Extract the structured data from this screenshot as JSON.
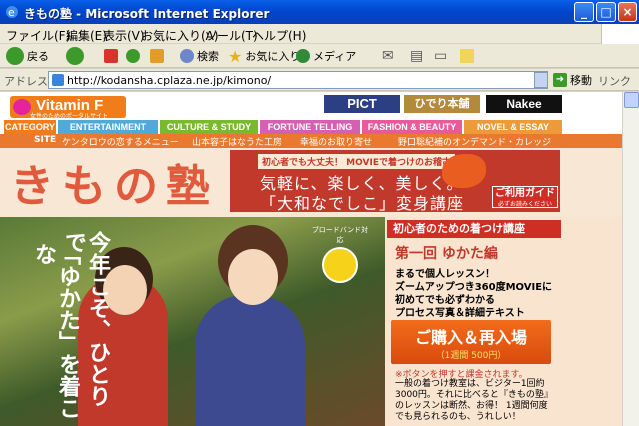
{
  "window": {
    "title": "きもの塾 - Microsoft Internet Explorer"
  },
  "menu": [
    "ファイル(F)",
    "編集(E)",
    "表示(V)",
    "お気に入り(A)",
    "ツール(T)",
    "ヘルプ(H)"
  ],
  "toolbar": {
    "back": "戻る",
    "search": "検索",
    "favorites": "お気に入り",
    "media": "メディア"
  },
  "address": {
    "label": "アドレス(D)",
    "url": "http://kodansha.cplaza.ne.jp/kimono/",
    "go": "移動",
    "links": "リンク"
  },
  "site": {
    "logo": "Vitamin F",
    "logo_sub": "女性のためのポータルサイト",
    "banners": [
      "PICT",
      "ひでり本舗",
      "Nakee"
    ],
    "categories": [
      {
        "label": "CATEGORY",
        "color": "#f07d1a"
      },
      {
        "label": "ENTERTAINMENT",
        "color": "#52a9d8"
      },
      {
        "label": "CULTURE & STUDY",
        "color": "#7ab830"
      },
      {
        "label": "FORTUNE TELLING",
        "color": "#d55fb0"
      },
      {
        "label": "FASHION & BEAUTY",
        "color": "#e85a9a"
      },
      {
        "label": "NOVEL & ESSAY",
        "color": "#ec9b38"
      }
    ],
    "site_label": "SITE",
    "site_links": [
      "ケンタロウの恋するメニュー",
      "山本容子はなうた工房",
      "幸福のお取り寄せ",
      "野口聡紀補のオンデマンド・カレッジ"
    ]
  },
  "hero": {
    "title": "きもの塾",
    "tag": "初心者でも大丈夫！ MOVIEで着つけのお稽古",
    "line1": "気軽に、楽しく、美しく。",
    "line2": "「大和なでしこ」変身講座",
    "guide": "ご利用ガイド",
    "guide_sub": "必ずお読みください"
  },
  "photo": {
    "text1": "今年こそ、ひとりで",
    "text2": "「ゆかた」を着こな",
    "broadband": "ブロードバンド対応"
  },
  "side": {
    "header": "初心者のための着つけ講座",
    "episode": "第一回 ゆかた編",
    "d1": "まるで個人レッスン！",
    "d2": "ズームアップつき360度MOVIEに",
    "d3": "初めてでも必ずわかる",
    "d4": "プロセス写真＆詳細テキスト",
    "buy": "ご購入＆再入場",
    "price": "（1週間 500円）",
    "note": "※ボタンを押すと課金されます。",
    "body": "一般の着つけ教室は、ビジター1回約3000円。それに比べると『きもの塾』のレッスンは断然、お得！ 1週間何度でも見られるのも、うれしい！"
  }
}
